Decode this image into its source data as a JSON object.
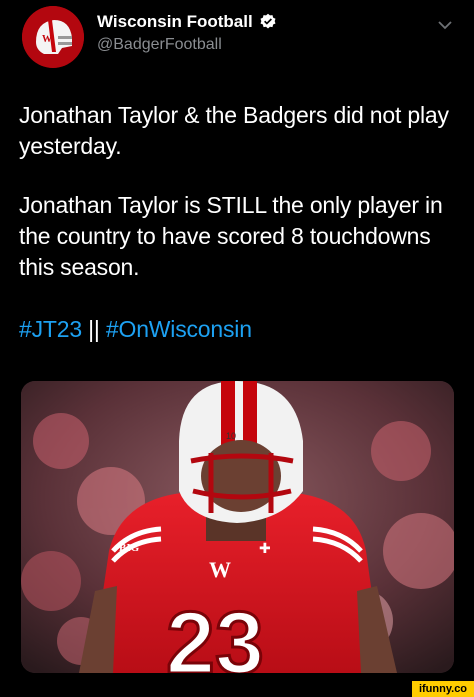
{
  "tweet": {
    "display_name": "Wisconsin Football",
    "handle": "@BadgerFootball",
    "paragraph1": "Jonathan Taylor & the Badgers did not play yesterday.",
    "paragraph2": "Jonathan Taylor is STILL the only player in the country to have scored 8 touchdowns this season.",
    "hashtag1": "#JT23",
    "separator": "||",
    "hashtag2": "#OnWisconsin",
    "accent_color": "#1da1f2"
  },
  "photo": {
    "jersey_number": "23",
    "conference_patch": "BIG",
    "icon": "football-player-photo"
  },
  "watermark": {
    "label": "ifunny.co"
  }
}
